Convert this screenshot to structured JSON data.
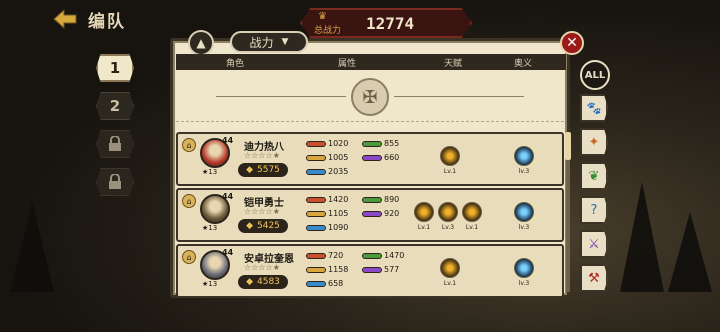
{
  "header": {
    "title": "编队",
    "power_label": "总战力",
    "power_value": "12774"
  },
  "team_slots": [
    "1",
    "2"
  ],
  "sort": {
    "label": "战力"
  },
  "filter_all": "ALL",
  "columns": {
    "role": "角色",
    "attr": "属性",
    "talent": "天赋",
    "mystery": "奥义"
  },
  "heroes": [
    {
      "name": "迪力热八",
      "level": "44",
      "rank": "13",
      "power": "5575",
      "hp": "1020",
      "atk": "855",
      "def": "1005",
      "spd": "660",
      "crit": "2035",
      "talents": [
        "Lv.1"
      ],
      "mystery": "lv.3"
    },
    {
      "name": "铠甲勇士",
      "level": "44",
      "rank": "13",
      "power": "5425",
      "hp": "1420",
      "atk": "890",
      "def": "1105",
      "spd": "920",
      "crit": "1090",
      "talents": [
        "Lv.1",
        "Lv.3",
        "Lv.1"
      ],
      "mystery": "lv.3"
    },
    {
      "name": "安卓拉奎恩",
      "level": "44",
      "rank": "13",
      "power": "4583",
      "hp": "720",
      "atk": "1470",
      "def": "1158",
      "spd": "577",
      "crit": "658",
      "talents": [
        "Lv.1"
      ],
      "mystery": "lv.3"
    }
  ],
  "colors": {
    "hp_bar": "#c8502e",
    "atk_bar": "#4a9a3a",
    "def_bar": "#d9a83c",
    "spd_bar": "#8a4ac8",
    "crit_bar": "#3a8ad0",
    "accent": "#9a1a18"
  }
}
